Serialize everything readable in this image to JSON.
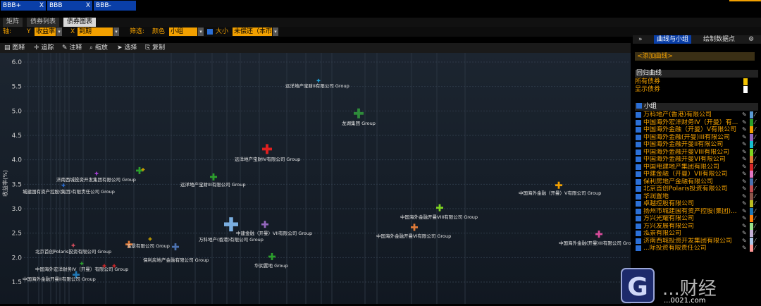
{
  "top_segments": [
    {
      "label": "BBB+",
      "close": "X"
    },
    {
      "label": "BBB",
      "close": "X"
    },
    {
      "label": "BBB-",
      "close": "X"
    }
  ],
  "tabs": [
    "矩阵",
    "债券列表",
    "债券图表"
  ],
  "filters": {
    "axis_label": "轴:",
    "y_label": "Y",
    "y_value": "收益率",
    "x_label": "X",
    "x_value": "到期",
    "filter_label": "筛选:",
    "color_label": "颜色",
    "color_value": "小组",
    "size_label": "大小",
    "size_value": "未偿还（本币"
  },
  "toolbar": [
    "图释",
    "追踪",
    "注释",
    "缩放",
    "选择",
    "复制"
  ],
  "right_tabs": [
    "»",
    "曲线与小组",
    "绘制数据点",
    "⚙"
  ],
  "right_panel": {
    "add_curve": "<添加曲线>",
    "regression_header": "回归曲线",
    "regression_items": [
      "所有债券",
      "显示债券"
    ],
    "group_header": "小组",
    "groups": [
      {
        "label": "万科地产(香港)有限公司",
        "color": "#5b9bd5"
      },
      {
        "label": "中国海外宏洋财务IV（开曼）有...",
        "color": "#2ca02c"
      },
      {
        "label": "中国海外金融（开曼）V有限公司",
        "color": "#f2a000"
      },
      {
        "label": "中国海外金融(开曼)III有限公司",
        "color": "#9467bd"
      },
      {
        "label": "中国海外金融开曼II有限公司",
        "color": "#17becf"
      },
      {
        "label": "中国海外金融开曼VIII有限公司",
        "color": "#7ed321"
      },
      {
        "label": "中国海外金融开曼VI有限公司",
        "color": "#e07b39"
      },
      {
        "label": "中国电建地产集团有限公司",
        "color": "#d62728"
      },
      {
        "label": "中建金融（开曼）VII有限公司",
        "color": "#e377c2"
      },
      {
        "label": "保利房地产金融有限公司",
        "color": "#4c72b0"
      },
      {
        "label": "北京首创Polaris投资有限公司",
        "color": "#c44e52"
      },
      {
        "label": "华润置地",
        "color": "#8c564b"
      },
      {
        "label": "卓越控股有限公司",
        "color": "#bcbd22"
      },
      {
        "label": "扬州市城建国有资产控股(集团)...",
        "color": "#1f77b4"
      },
      {
        "label": "方兴光耀有限公司",
        "color": "#ff7f0e"
      },
      {
        "label": "方兴发展有限公司",
        "color": "#98df8a"
      },
      {
        "label": "泓景有限公司",
        "color": "#c5b0d5"
      },
      {
        "label": "济南西城投资开发集团有限公司",
        "color": "#aec7e8"
      },
      {
        "label": "...际投资有限责任公司",
        "color": "#ff9896"
      }
    ]
  },
  "watermark": {
    "text": "...财经",
    "url": "...0021.com"
  },
  "chart_data": {
    "type": "scatter",
    "title": "",
    "xlabel": "",
    "ylabel": "收益率(%)",
    "ylim": [
      1.4,
      6.1
    ],
    "yticks": [
      "6.0",
      "5.5",
      "5.0",
      "4.5",
      "4.0",
      "3.5",
      "3.0",
      "2.5",
      "2.0",
      "1.5"
    ],
    "points": [
      {
        "label": "远洋地产宝财II有限公司 Group",
        "x": 2,
        "y": 5.62,
        "size": 1,
        "color": "#1ea7e1"
      },
      {
        "label": "龙湖集团 Group",
        "x": 3,
        "y": 4.95,
        "size": 3,
        "color": "#2e8b3a"
      },
      {
        "label": "远洋地产宝财IV有限公司 Group",
        "x": 4,
        "y": 4.22,
        "size": 3,
        "color": "#e02020"
      },
      {
        "label": "济南西城投资开发集团有限公司 Group",
        "x": 5,
        "y": 3.72,
        "size": 1,
        "color": "#b040e0"
      },
      {
        "label": "城建国有资产控股(集团)有限责任公司 Group",
        "x": 6,
        "y": 3.48,
        "size": 1,
        "color": "#2b6fd6"
      },
      {
        "label": "",
        "x": 7,
        "y": 3.78,
        "size": 2,
        "color": "#2ca02c"
      },
      {
        "label": "",
        "x": 8,
        "y": 3.8,
        "size": 1,
        "color": "#c7a000"
      },
      {
        "label": "远洋地产宝财III有限公司 Group",
        "x": 9,
        "y": 3.65,
        "size": 2,
        "color": "#2ca02c"
      },
      {
        "label": "中国海外金融（开曼）V有限公司 Group",
        "x": 10,
        "y": 3.48,
        "size": 2,
        "color": "#f2a000"
      },
      {
        "label": "中国海外金融开曼VIII有限公司 Group",
        "x": 11,
        "y": 3.02,
        "size": 2,
        "color": "#7ed321"
      },
      {
        "label": "中国海外金融开曼VI有限公司 Group",
        "x": 12,
        "y": 2.62,
        "size": 2,
        "color": "#e07b39"
      },
      {
        "label": "中国海外金融(开曼)III有限公司 Group",
        "x": 13,
        "y": 2.48,
        "size": 2,
        "color": "#d84a9a"
      },
      {
        "label": "中建金融（开曼）VII有限公司 Group",
        "x": 14,
        "y": 2.68,
        "size": 2,
        "color": "#9467bd"
      },
      {
        "label": "万科地产(香港)有限公司 Group",
        "x": 15,
        "y": 2.68,
        "size": 4,
        "color": "#7aaee0"
      },
      {
        "label": "华润置地 Group",
        "x": 16,
        "y": 2.02,
        "size": 2,
        "color": "#2ca02c"
      },
      {
        "label": "保利房地产金融有限公司 Group",
        "x": 17,
        "y": 2.22,
        "size": 2,
        "color": "#4c72b0"
      },
      {
        "label": "泓景有限公司 Group",
        "x": 18,
        "y": 2.27,
        "size": 2,
        "color": "#e07b39"
      },
      {
        "label": "",
        "x": 19,
        "y": 2.38,
        "size": 1,
        "color": "#c7a000"
      },
      {
        "label": "北京首创Polaris投资有限公司 Group",
        "x": 20,
        "y": 2.25,
        "size": 1,
        "color": "#e05060"
      },
      {
        "label": "中国海外宏洋财务IV（开曼）有限公司 Group",
        "x": 21,
        "y": 1.88,
        "size": 1,
        "color": "#2ca02c"
      },
      {
        "label": "",
        "x": 22,
        "y": 1.83,
        "size": 1,
        "color": "#d62728"
      },
      {
        "label": "",
        "x": 23,
        "y": 1.83,
        "size": 1,
        "color": "#d62728"
      },
      {
        "label": "中国海外金融开曼II有限公司 Group",
        "x": 24,
        "y": 1.65,
        "size": 2,
        "color": "#1f77b4"
      }
    ]
  }
}
